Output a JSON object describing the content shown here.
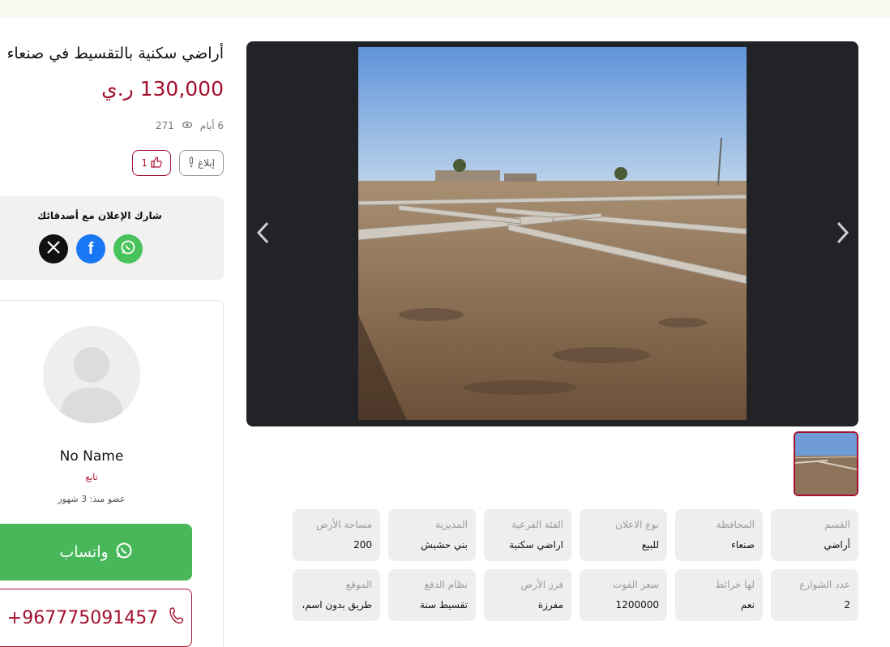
{
  "listing": {
    "title": "أراضي سكنية بالتقسيط في صنعاء",
    "price": "130,000 ر.ي",
    "age": "6 أيام",
    "views": "271",
    "report_label": "إبلاغ",
    "like_count": "1"
  },
  "share": {
    "title": "شارك الإعلان مع أصدقائك",
    "networks": [
      "x-icon",
      "facebook-icon",
      "whatsapp-icon"
    ]
  },
  "seller": {
    "name": "No Name",
    "role": "تابع",
    "member_since": "عضو منذ: 3 شهور",
    "whatsapp_label": "واتساب",
    "phone": "+967775091457"
  },
  "details": [
    {
      "label": "القسم",
      "value": "أراضي"
    },
    {
      "label": "المحافظة",
      "value": "صنعاء"
    },
    {
      "label": "نوع الاعلان",
      "value": "للبيع"
    },
    {
      "label": "الفئة الفرعية",
      "value": "اراضي سكنية"
    },
    {
      "label": "المديرية",
      "value": "بني حشيش"
    },
    {
      "label": "مساحة الأرض",
      "value": "200"
    },
    {
      "label": "عدد الشوارع",
      "value": "2"
    },
    {
      "label": "لها خرائط",
      "value": "نعم"
    },
    {
      "label": "سعر الفوت",
      "value": "1200000"
    },
    {
      "label": "فرز الأرض",
      "value": "مفرزة"
    },
    {
      "label": "نظام الدفع",
      "value": "تقسيط سنة"
    },
    {
      "label": "الموقع",
      "value": "طريق بدون اسم،"
    }
  ],
  "colors": {
    "brand": "#a30f2d",
    "whatsapp": "#47b75a",
    "facebook": "#1877f2",
    "x": "#111111",
    "gallery_bg": "#212327"
  }
}
